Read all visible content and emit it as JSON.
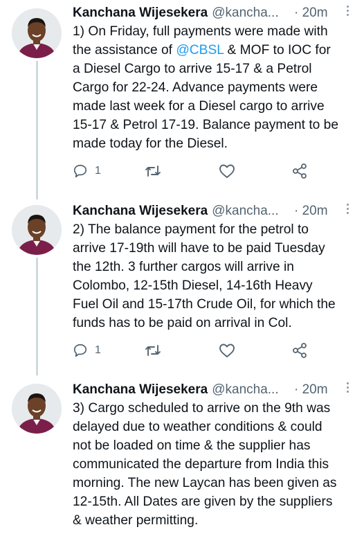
{
  "tweets": [
    {
      "author_name": "Kanchana Wijesekera",
      "handle": "@kancha...",
      "time": "· 20m",
      "text_before": "1) On Friday, full payments were made with\nthe assistance of ",
      "mention": "@CBSL",
      "text_after": " & MOF to IOC for\na Diesel Cargo to arrive 15-17 & a Petrol\nCargo for 22-24. Advance payments were\nmade last week for a Diesel cargo to arrive\n15-17 & Petrol 17-19. Balance payment to be\nmade today for the Diesel.",
      "reply_count": "1"
    },
    {
      "author_name": "Kanchana Wijesekera",
      "handle": "@kancha...",
      "time": "· 20m",
      "text": "2) The balance payment for the petrol to\narrive 17-19th will have to be paid Tuesday\nthe 12th. 3 further cargos will arrive in\nColombo, 12-15th Diesel, 14-16th Heavy\nFuel Oil and 15-17th Crude Oil, for which the\nfunds has to be paid on arrival in Col.",
      "reply_count": "1"
    },
    {
      "author_name": "Kanchana Wijesekera",
      "handle": "@kancha...",
      "time": "· 20m",
      "text": "3) Cargo scheduled to arrive on the 9th was\ndelayed due to weather conditions & could\nnot be loaded on time & the supplier has\ncommunicated the departure from India this\nmorning. The new Laycan has been given as\n12-15th. All Dates are given by the suppliers\n& weather permitting."
    }
  ],
  "colors": {
    "mention": "#1d9bf0",
    "secondary_text": "#536471",
    "thread_line": "#cfd9de"
  },
  "icons": [
    "reply-icon",
    "retweet-icon",
    "like-icon",
    "share-icon",
    "more-icon",
    "avatar"
  ]
}
